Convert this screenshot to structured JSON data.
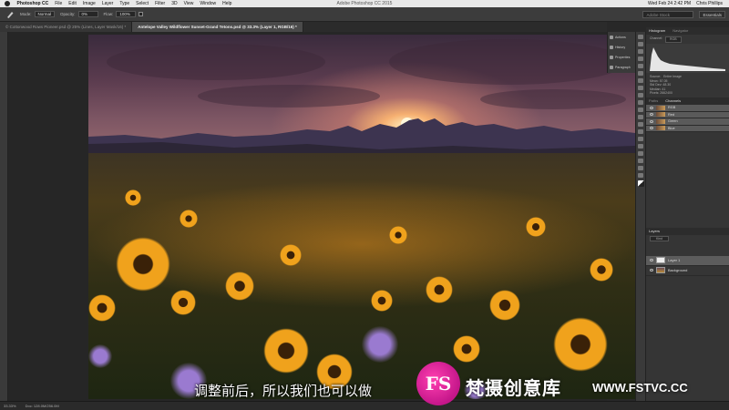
{
  "menubar": {
    "items": [
      "Photoshop CC",
      "File",
      "Edit",
      "Image",
      "Layer",
      "Type",
      "Select",
      "Filter",
      "3D",
      "View",
      "Window",
      "Help"
    ],
    "window_title": "Adobe Photoshop CC 2015",
    "clock": "Wed Feb 24  2:42 PM",
    "user": "Chris Phillips"
  },
  "options_bar": {
    "mode_label": "Mode:",
    "mode_value": "Normal",
    "opacity_label": "Opacity:",
    "opacity_value": "0%",
    "flow_label": "Flow:",
    "flow_value": "100%",
    "search_placeholder": "Adobe Stock",
    "workspace": "Essentials"
  },
  "tabs": [
    {
      "label": "© Cottonwood Rows Pioneer.psd @ 25% (Lines, Layer Mask/16) *"
    },
    {
      "label": "Antelope Valley Wildflower Sunset-Grand Tetons.psd @ 33.3% (Layer 1, RGB/16) *"
    }
  ],
  "mini_panel": [
    "Actions",
    "History",
    "Properties",
    "Paragraph"
  ],
  "panels": {
    "histogram_tabs": [
      "Histogram",
      "Navigator"
    ],
    "channel_label": "Channel:",
    "channel_value": "RGB",
    "source_label": "Source:",
    "source_value": "Entire Image",
    "stats": [
      "Mean: 57.05",
      "Std Dev: 48.30",
      "Median: 41",
      "Pixels: 2662400"
    ],
    "channels_tabs": [
      "Paths",
      "Channels"
    ],
    "channels": [
      "RGB",
      "Red",
      "Green",
      "Blue"
    ],
    "layers_tab": "Layers",
    "layers_kind": "Kind",
    "layers": [
      "Layer 1",
      "Background"
    ]
  },
  "status": {
    "zoom": "33.33%",
    "doc": "Doc: 128.0M/256.0M"
  },
  "subtitle": "调整前后，所以我们也可以做",
  "watermark": {
    "logo": "FS",
    "name": "梵摄创意库",
    "url": "WWW.FSTVC.CC"
  },
  "colors": {
    "app_bg": "#282828",
    "panel_bg": "#353535",
    "watermark_pink": "#d0188f"
  }
}
